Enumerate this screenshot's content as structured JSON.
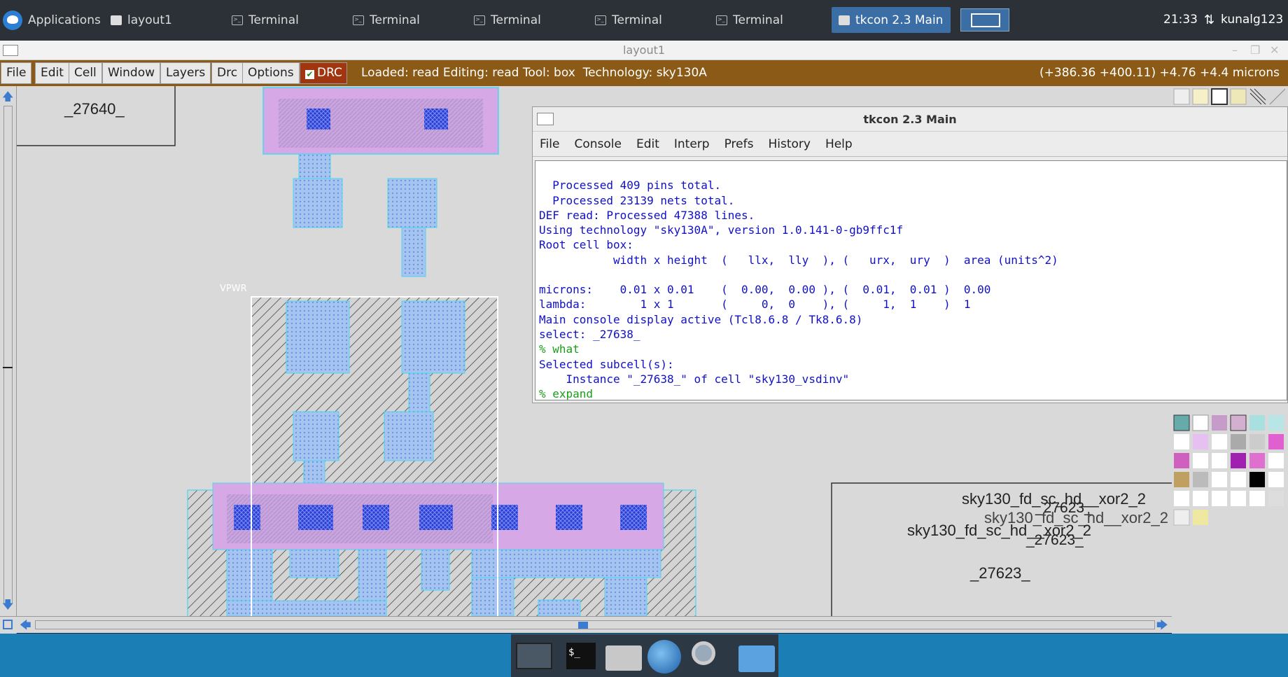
{
  "panel": {
    "applications": "Applications",
    "tasks": [
      {
        "label": "layout1",
        "active": false
      },
      {
        "label": "Terminal",
        "active": false
      },
      {
        "label": "Terminal",
        "active": false
      },
      {
        "label": "Terminal",
        "active": false
      },
      {
        "label": "Terminal",
        "active": false
      },
      {
        "label": "Terminal",
        "active": false
      },
      {
        "label": "tkcon 2.3 Main",
        "active": true
      }
    ],
    "clock": "21:33",
    "user": "kunalg123"
  },
  "window": {
    "title": "layout1"
  },
  "menubar": {
    "items": [
      "File",
      "Edit",
      "Cell",
      "Window",
      "Layers",
      "Drc",
      "Options"
    ],
    "drc_label": "DRC",
    "status": "Loaded: read Editing: read Tool: box  Technology: sky130A",
    "coords": "(+386.36 +400.11) +4.76 +4.4 microns"
  },
  "layout": {
    "cell_top_left": "_27640_",
    "vpwr_label": "VPWR",
    "xor_label_1": "sky130_fd_sc_hd__xor2_2",
    "xor_label_1b": "sky130_fd_sc_hd__xor2_2",
    "xor_label_2": "sky130_fd_sc_hd__xor2_2",
    "inst_label_1": "_27623_",
    "inst_label_2": "_27623_",
    "inst_label_3": "_27623_"
  },
  "tkcon": {
    "title": "tkcon 2.3 Main",
    "menu": [
      "File",
      "Console",
      "Edit",
      "Interp",
      "Prefs",
      "History",
      "Help"
    ],
    "lines": [
      {
        "text": "  Processed 409 pins total.",
        "prompt": false
      },
      {
        "text": "  Processed 23139 nets total.",
        "prompt": false
      },
      {
        "text": "DEF read: Processed 47388 lines.",
        "prompt": false
      },
      {
        "text": "Using technology \"sky130A\", version 1.0.141-0-gb9ffc1f",
        "prompt": false
      },
      {
        "text": "Root cell box:",
        "prompt": false
      },
      {
        "text": "           width x height  (   llx,  lly  ), (   urx,  ury  )  area (units^2)",
        "prompt": false
      },
      {
        "text": "",
        "prompt": false
      },
      {
        "text": "microns:    0.01 x 0.01    (  0.00,  0.00 ), (  0.01,  0.01 )  0.00",
        "prompt": false
      },
      {
        "text": "lambda:        1 x 1       (     0,  0    ), (     1,  1    )  1",
        "prompt": false
      },
      {
        "text": "Main console display active (Tcl8.6.8 / Tk8.6.8)",
        "prompt": false
      },
      {
        "text": "select: _27638_",
        "prompt": false
      },
      {
        "text": "% what",
        "prompt": true
      },
      {
        "text": "Selected subcell(s):",
        "prompt": false
      },
      {
        "text": "    Instance \"_27638_\" of cell \"sky130_vsdinv\"",
        "prompt": false
      },
      {
        "text": "% expand",
        "prompt": true
      },
      {
        "text": "%",
        "prompt": true
      }
    ]
  }
}
